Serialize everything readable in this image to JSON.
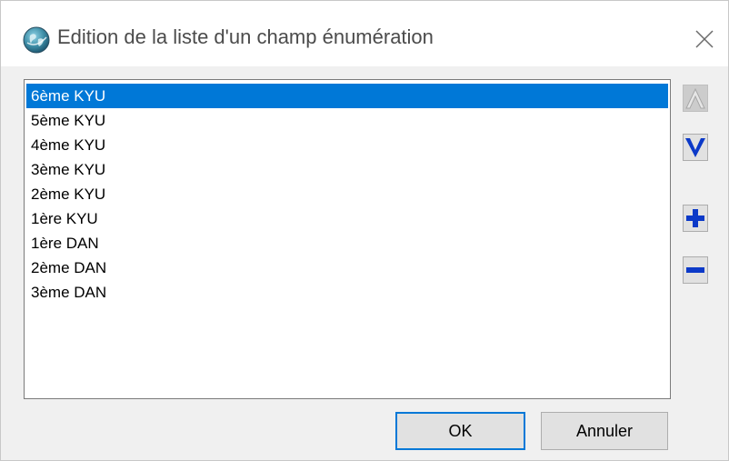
{
  "window": {
    "title": "Edition de la liste d'un champ énumération",
    "close_symbol": "✕"
  },
  "list": {
    "items": [
      {
        "label": "6ème KYU",
        "selected": true
      },
      {
        "label": "5ème KYU",
        "selected": false
      },
      {
        "label": "4ème KYU",
        "selected": false
      },
      {
        "label": "3ème KYU",
        "selected": false
      },
      {
        "label": "2ème KYU",
        "selected": false
      },
      {
        "label": "1ère KYU",
        "selected": false
      },
      {
        "label": "1ère DAN",
        "selected": false
      },
      {
        "label": "2ème DAN",
        "selected": false
      },
      {
        "label": "3ème DAN",
        "selected": false
      }
    ]
  },
  "side_buttons": {
    "move_up_icon": "arrow-up-icon",
    "move_down_icon": "arrow-down-icon",
    "add_icon": "plus-icon",
    "remove_icon": "minus-icon"
  },
  "buttons": {
    "ok_label": "OK",
    "cancel_label": "Annuler"
  },
  "colors": {
    "selection": "#0078d7",
    "icon_blue": "#0b39c8",
    "disabled_icon": "#b0b0b0"
  }
}
